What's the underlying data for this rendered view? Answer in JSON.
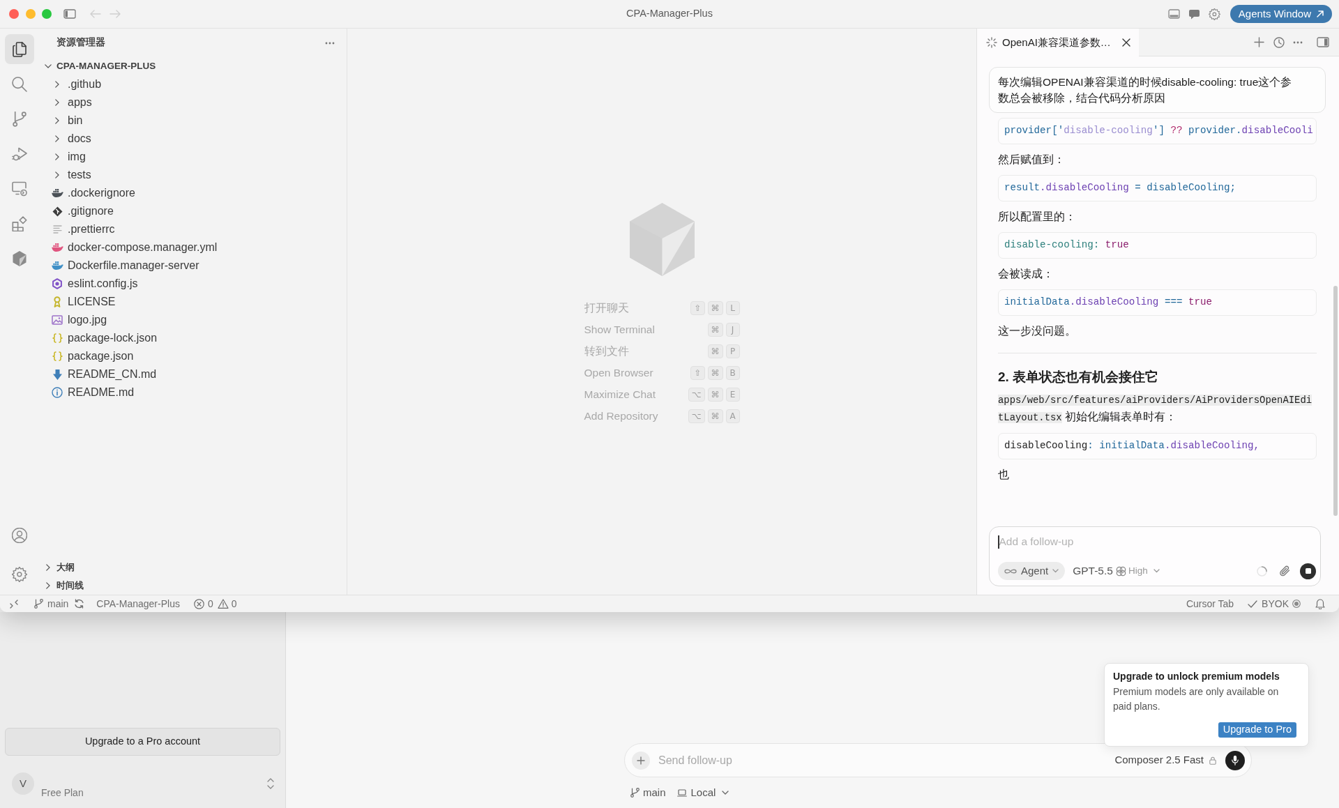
{
  "window": {
    "title": "CPA-Manager-Plus",
    "agents_button": "Agents Window"
  },
  "activity_bar": {
    "items": [
      {
        "kind": "files",
        "selected": true
      },
      {
        "kind": "search",
        "selected": false
      },
      {
        "kind": "branch",
        "selected": false
      },
      {
        "kind": "debug",
        "selected": false
      },
      {
        "kind": "remote",
        "selected": false
      },
      {
        "kind": "extensions",
        "selected": false
      },
      {
        "kind": "cube",
        "selected": false
      }
    ],
    "bottom": [
      {
        "kind": "account"
      },
      {
        "kind": "settings"
      }
    ]
  },
  "explorer": {
    "title": "资源管理器",
    "root": {
      "label": "CPA-MANAGER-PLUS",
      "expanded": true,
      "children": [
        {
          "label": ".github",
          "kind": "folder",
          "expanded": false
        },
        {
          "label": "apps",
          "kind": "folder",
          "expanded": false
        },
        {
          "label": "bin",
          "kind": "folder",
          "expanded": false
        },
        {
          "label": "docs",
          "kind": "folder",
          "expanded": false
        },
        {
          "label": "img",
          "kind": "folder",
          "expanded": false
        },
        {
          "label": "tests",
          "kind": "folder",
          "expanded": false
        },
        {
          "label": ".dockerignore",
          "kind": "dockerignore"
        },
        {
          "label": ".gitignore",
          "kind": "gitignore"
        },
        {
          "label": ".prettierrc",
          "kind": "config"
        },
        {
          "label": "docker-compose.manager.yml",
          "kind": "compose"
        },
        {
          "label": "Dockerfile.manager-server",
          "kind": "dockerfile"
        },
        {
          "label": "eslint.config.js",
          "kind": "eslint"
        },
        {
          "label": "LICENSE",
          "kind": "license"
        },
        {
          "label": "logo.jpg",
          "kind": "image"
        },
        {
          "label": "package-lock.json",
          "kind": "json"
        },
        {
          "label": "package.json",
          "kind": "json"
        },
        {
          "label": "README_CN.md",
          "kind": "markdown"
        },
        {
          "label": "README.md",
          "kind": "readme"
        }
      ]
    },
    "sections": [
      {
        "label": "大纲",
        "expanded": false
      },
      {
        "label": "时间线",
        "expanded": false
      }
    ]
  },
  "editor": {
    "shortcuts": [
      {
        "label": "打开聊天",
        "keys": [
          "⇧",
          "⌘",
          "L"
        ]
      },
      {
        "label": "Show Terminal",
        "keys": [
          "⌘",
          "J"
        ]
      },
      {
        "label": "转到文件",
        "keys": [
          "⌘",
          "P"
        ]
      },
      {
        "label": "Open Browser",
        "keys": [
          "⇧",
          "⌘",
          "B"
        ]
      },
      {
        "label": "Maximize Chat",
        "keys": [
          "⌥",
          "⌘",
          "E"
        ]
      },
      {
        "label": "Add Repository",
        "keys": [
          "⌥",
          "⌘",
          "A"
        ]
      }
    ]
  },
  "chat": {
    "tab": {
      "title": "OpenAI兼容渠道参数…",
      "selected": true
    },
    "user_message": "每次编辑OPENAI兼容渠道的时候disable-cooling: true这个参数总会被移除，结合代码分析原因",
    "blocks": [
      {
        "kind": "code",
        "tokens": [
          {
            "text": "provider",
            "kind": "variable"
          },
          {
            "text": "['",
            "kind": "punct"
          },
          {
            "text": "disable-cooling",
            "kind": "string"
          },
          {
            "text": "']",
            "kind": "punct"
          },
          {
            "text": " ?? ",
            "kind": "operator"
          },
          {
            "text": "provider",
            "kind": "variable"
          },
          {
            "text": ".",
            "kind": "punct"
          },
          {
            "text": "disableCooli",
            "kind": "property"
          }
        ]
      },
      {
        "kind": "text",
        "text": "然后赋值到："
      },
      {
        "kind": "code",
        "tokens": [
          {
            "text": "result",
            "kind": "variable"
          },
          {
            "text": ".disableCooling",
            "kind": "property"
          },
          {
            "text": " = ",
            "kind": "punct"
          },
          {
            "text": "disableCooling;",
            "kind": "variable"
          }
        ]
      },
      {
        "kind": "text",
        "text": "所以配置里的："
      },
      {
        "kind": "code",
        "tokens": [
          {
            "text": "disable-cooling:",
            "kind": "key"
          },
          {
            "text": " true",
            "kind": "literal"
          }
        ]
      },
      {
        "kind": "text",
        "text": "会被读成："
      },
      {
        "kind": "code",
        "tokens": [
          {
            "text": "initialData",
            "kind": "variable"
          },
          {
            "text": ".disableCooling",
            "kind": "property"
          },
          {
            "text": " === ",
            "kind": "punct"
          },
          {
            "text": "true",
            "kind": "literal"
          }
        ]
      },
      {
        "kind": "text",
        "text": "这一步没问题。"
      },
      {
        "kind": "rule"
      },
      {
        "kind": "heading",
        "text": "2. 表单状态也有机会接住它"
      },
      {
        "kind": "paragraph",
        "parts": [
          {
            "text": "apps/web/src/features/aiProviders/AiProvidersOpenAIEditLayout.tsx",
            "code": true
          },
          {
            "text": " 初始化编辑表单时有：",
            "code": false
          }
        ]
      },
      {
        "kind": "code",
        "tokens": [
          {
            "text": "disableCooling",
            "kind": "plain"
          },
          {
            "text": ": ",
            "kind": "punct"
          },
          {
            "text": "initialData",
            "kind": "variable"
          },
          {
            "text": ".disableCooling,",
            "kind": "property"
          }
        ]
      },
      {
        "kind": "text",
        "text": "也"
      }
    ],
    "input": {
      "placeholder": "Add a follow-up",
      "mode": "Agent",
      "model": "GPT-5.5",
      "effort": "High"
    }
  },
  "status_bar": {
    "branch": "main",
    "project": "CPA-Manager-Plus",
    "errors": "0",
    "warnings": "0",
    "cursor_tab": "Cursor Tab",
    "byok": "BYOK"
  },
  "background_window": {
    "sidebar": {
      "upgrade_button": "Upgrade to a Pro account",
      "avatar": "V",
      "plan": "Free Plan"
    },
    "composer": {
      "placeholder": "Send follow-up",
      "model": "Composer 2.5 Fast"
    },
    "footer": {
      "branch": "main",
      "location": "Local"
    },
    "popup": {
      "title": "Upgrade to unlock premium models",
      "body": "Premium models are only available on paid plans.",
      "button": "Upgrade to Pro"
    }
  }
}
